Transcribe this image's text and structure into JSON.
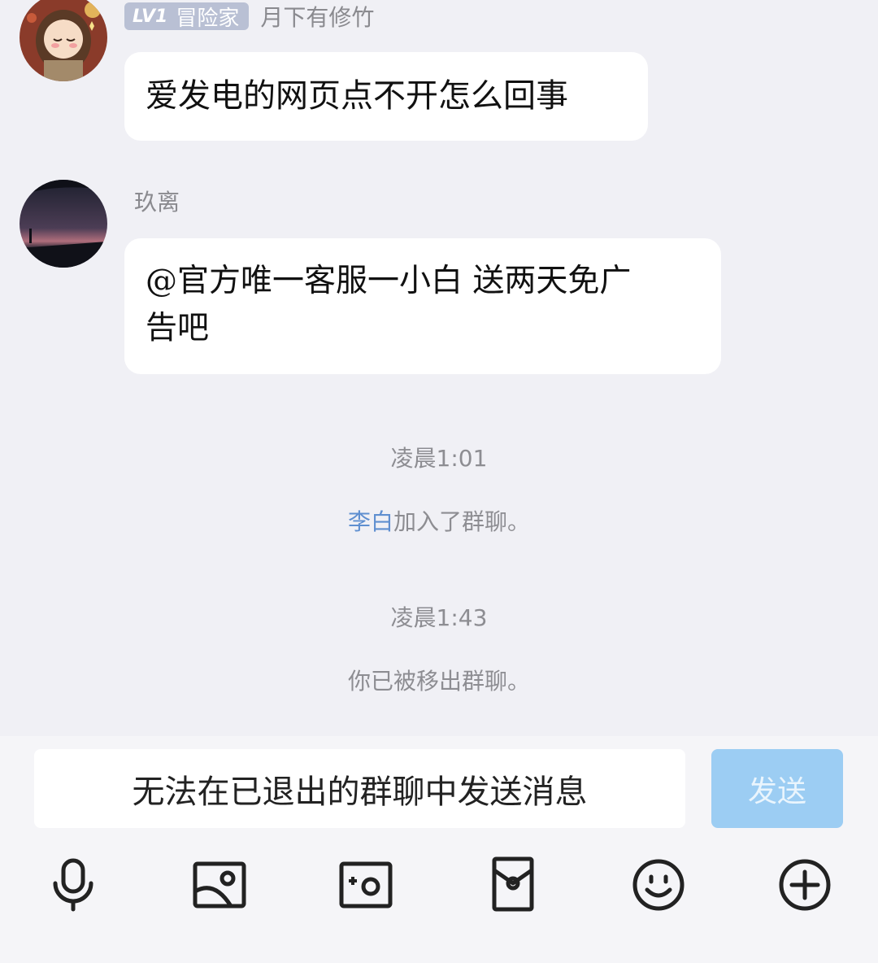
{
  "messages": [
    {
      "badge_level": "LV1",
      "badge_title": "冒险家",
      "sender": "月下有修竹",
      "text": "爱发电的网页点不开怎么回事"
    },
    {
      "sender": "玖离",
      "text_line1": "@官方唯一客服一小白 送两天免广",
      "text_line2": "告吧"
    }
  ],
  "events": [
    {
      "time": "凌晨1:01",
      "user": "李白",
      "action": "加入了群聊。"
    },
    {
      "time": "凌晨1:43",
      "text": "你已被移出群聊。"
    }
  ],
  "composer": {
    "input_text": "无法在已退出的群聊中发送消息",
    "send_label": "发送"
  },
  "toolbar": {
    "icons": [
      "microphone-icon",
      "image-icon",
      "camera-icon",
      "red-envelope-icon",
      "emoji-icon",
      "plus-icon"
    ]
  },
  "colors": {
    "background": "#f0f0f5",
    "bubble": "#ffffff",
    "send_button_disabled": "#9ccdf3",
    "mention_link": "#5f8fd0",
    "badge": "#b9c0d4"
  }
}
